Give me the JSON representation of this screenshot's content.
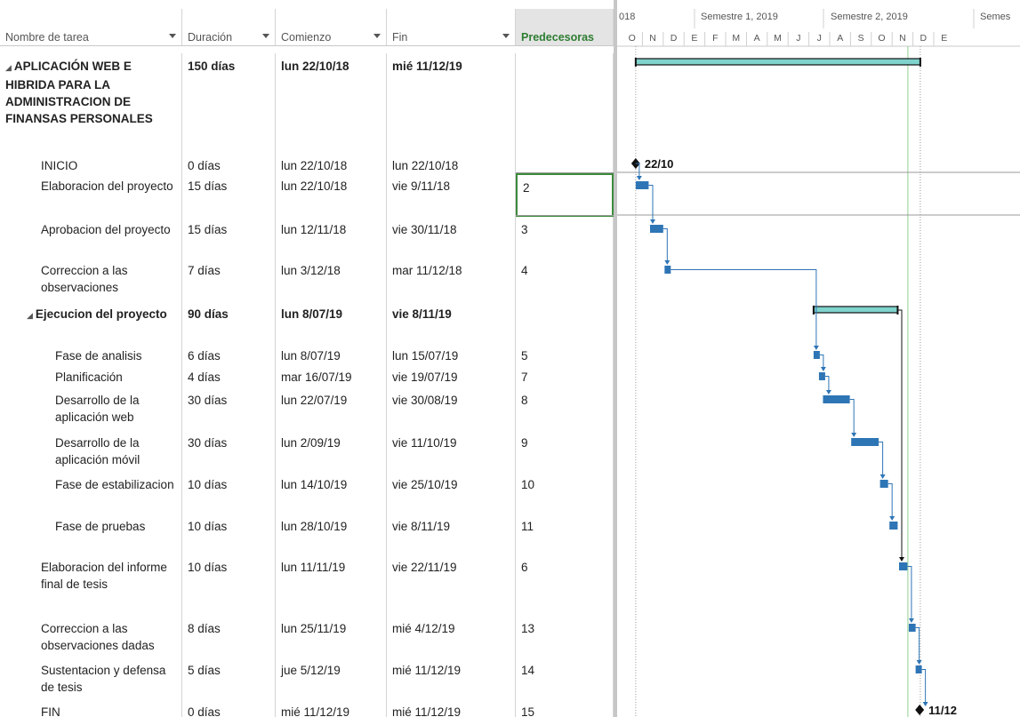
{
  "columns": {
    "name": "Nombre de tarea",
    "duration": "Duración",
    "start": "Comienzo",
    "end": "Fin",
    "pred": "Predecesoras"
  },
  "timescale": {
    "top": [
      "018",
      "Semestre 1, 2019",
      "Semestre 2, 2019",
      "Semes"
    ],
    "months": [
      "O",
      "N",
      "D",
      "E",
      "F",
      "M",
      "A",
      "M",
      "J",
      "J",
      "A",
      "S",
      "O",
      "N",
      "D",
      "E"
    ]
  },
  "tasks": [
    {
      "name": "APLICACIÓN WEB E HIBRIDA PARA LA ADMINISTRACION DE FINANSAS PERSONALES",
      "dur": "150 días",
      "start": "lun 22/10/18",
      "end": "mié 11/12/19",
      "pred": "",
      "summary": true,
      "level": 0
    },
    {
      "name": "INICIO",
      "dur": "0 días",
      "start": "lun 22/10/18",
      "end": "lun 22/10/18",
      "pred": "",
      "summary": false,
      "level": 1,
      "milestone_label": "22/10"
    },
    {
      "name": "Elaboracion del proyecto",
      "dur": "15 días",
      "start": "lun 22/10/18",
      "end": "vie 9/11/18",
      "pred": "2",
      "summary": false,
      "level": 1
    },
    {
      "name": "Aprobacion del proyecto",
      "dur": "15 días",
      "start": "lun 12/11/18",
      "end": "vie 30/11/18",
      "pred": "3",
      "summary": false,
      "level": 1
    },
    {
      "name": "Correccion a las observaciones",
      "dur": "7 días",
      "start": "lun 3/12/18",
      "end": "mar 11/12/18",
      "pred": "4",
      "summary": false,
      "level": 1
    },
    {
      "name": "Ejecucion del proyecto",
      "dur": "90 días",
      "start": "lun 8/07/19",
      "end": "vie 8/11/19",
      "pred": "",
      "summary": true,
      "level": 1
    },
    {
      "name": "Fase de analisis",
      "dur": "6 días",
      "start": "lun 8/07/19",
      "end": "lun 15/07/19",
      "pred": "5",
      "summary": false,
      "level": 2
    },
    {
      "name": "Planificación",
      "dur": "4 días",
      "start": "mar 16/07/19",
      "end": "vie 19/07/19",
      "pred": "7",
      "summary": false,
      "level": 2
    },
    {
      "name": "Desarrollo de la aplicación web",
      "dur": "30 días",
      "start": "lun 22/07/19",
      "end": "vie 30/08/19",
      "pred": "8",
      "summary": false,
      "level": 2
    },
    {
      "name": "Desarrollo de la aplicación móvil",
      "dur": "30 días",
      "start": "lun 2/09/19",
      "end": "vie 11/10/19",
      "pred": "9",
      "summary": false,
      "level": 2
    },
    {
      "name": "Fase de estabilizacion",
      "dur": "10 días",
      "start": "lun 14/10/19",
      "end": "vie 25/10/19",
      "pred": "10",
      "summary": false,
      "level": 2
    },
    {
      "name": "Fase de pruebas",
      "dur": "10 días",
      "start": "lun 28/10/19",
      "end": "vie 8/11/19",
      "pred": "11",
      "summary": false,
      "level": 2
    },
    {
      "name": "Elaboracion del informe final de tesis",
      "dur": "10 días",
      "start": "lun 11/11/19",
      "end": "vie 22/11/19",
      "pred": "6",
      "summary": false,
      "level": 1
    },
    {
      "name": "Correccion a las observaciones dadas",
      "dur": "8 días",
      "start": "lun 25/11/19",
      "end": "mié 4/12/19",
      "pred": "13",
      "summary": false,
      "level": 1
    },
    {
      "name": "Sustentacion y defensa de tesis",
      "dur": "5 días",
      "start": "jue 5/12/19",
      "end": "mié 11/12/19",
      "pred": "14",
      "summary": false,
      "level": 1
    },
    {
      "name": "FIN",
      "dur": "0 días",
      "start": "mié 11/12/19",
      "end": "mié 11/12/19",
      "pred": "15",
      "summary": false,
      "level": 1,
      "milestone_label": "11/12"
    }
  ],
  "colors": {
    "task_bar": "#2e75b6",
    "summary_bar": "#7fd3cc",
    "link": "#2e75b6",
    "selection": "#3d8b3d",
    "today_line": "#8fd08f"
  },
  "selected_cell": {
    "row": 2,
    "column": "pred"
  }
}
